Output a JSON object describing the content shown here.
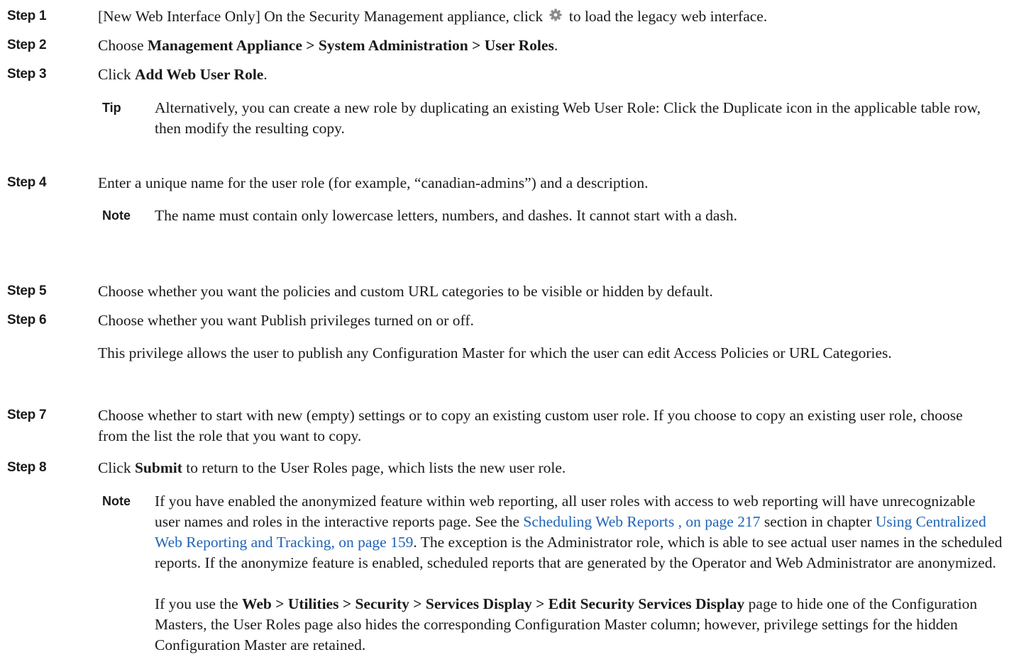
{
  "steps": [
    {
      "label": "Step 1",
      "text_before": "[New Web Interface Only] On the Security Management appliance, click",
      "icon": "gear-icon",
      "text_after": "to load the legacy web interface."
    },
    {
      "label": "Step 2",
      "prefix": "Choose ",
      "bold": "Management Appliance > System Administration > User Roles",
      "suffix": "."
    },
    {
      "label": "Step 3",
      "prefix": "Click ",
      "bold": "Add Web User Role",
      "suffix": ".",
      "tip_label": "Tip",
      "tip_text": "Alternatively, you can create a new role by duplicating an existing Web User Role: Click the Duplicate icon in the applicable table row, then modify the resulting copy."
    },
    {
      "label": "Step 4",
      "text": "Enter a unique name for the user role (for example, “canadian-admins”) and a description.",
      "note_label": "Note",
      "note_text": "The name must contain only lowercase letters, numbers, and dashes. It cannot start with a dash."
    },
    {
      "label": "Step 5",
      "text": "Choose whether you want the policies and custom URL categories to be visible or hidden by default."
    },
    {
      "label": "Step 6",
      "text": "Choose whether you want Publish privileges turned on or off.",
      "para": "This privilege allows the user to publish any Configuration Master for which the user can edit Access Policies or URL Categories."
    },
    {
      "label": "Step 7",
      "text": "Choose whether to start with new (empty) settings or to copy an existing custom user role. If you choose to copy an existing user role, choose from the list the role that you want to copy."
    },
    {
      "label": "Step 8",
      "prefix": "Click ",
      "bold": "Submit",
      "suffix": " to return to the User Roles page, which lists the new user role.",
      "note_label": "Note",
      "note_p1": "If you have enabled the anonymized feature within web reporting, all user roles with access to web reporting will have unrecognizable user names and roles in the interactive reports page. See the ",
      "note_link1": "Scheduling Web Reports , on page 217",
      "note_p2": " section in chapter ",
      "note_link2": "Using Centralized Web Reporting and Tracking, on page 159",
      "note_p3": ". The exception is the Administrator role, which is able to see actual user names in the scheduled reports. If the anonymize feature is enabled, scheduled reports that are generated by the Operator and Web Administrator are anonymized.",
      "para_prefix": "If you use the ",
      "para_bold": "Web > Utilities > Security > Services Display > Edit Security Services Display",
      "para_suffix": " page to hide one of the Configuration Masters, the User Roles page also hides the corresponding Configuration Master column; however, privilege settings for the hidden Configuration Master are retained."
    }
  ],
  "colors": {
    "text": "#1a1a1a",
    "link": "#1f64b8",
    "icon": "#8a8a8a"
  }
}
